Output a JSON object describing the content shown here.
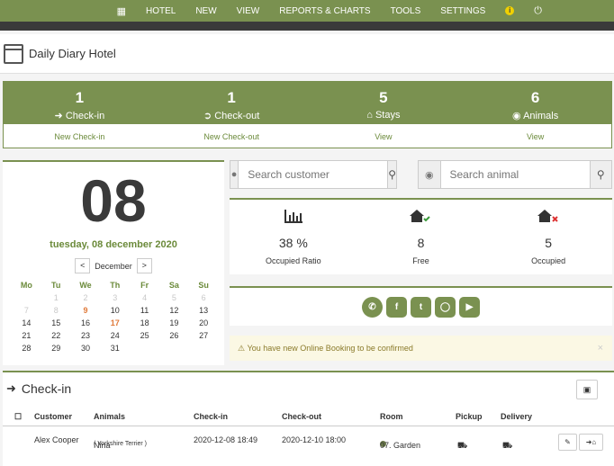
{
  "nav": {
    "items": [
      "HOTEL",
      "NEW",
      "VIEW",
      "REPORTS & CHARTS",
      "TOOLS",
      "SETTINGS"
    ],
    "info_icon": "info-icon",
    "power_icon": "power-icon",
    "grid_icon": "grid-icon"
  },
  "title": "Daily Diary Hotel",
  "stats": [
    {
      "num": "1",
      "label": "Check-in",
      "link": "New Check-in",
      "icon": "sign-in-icon"
    },
    {
      "num": "1",
      "label": "Check-out",
      "link": "New Check-out",
      "icon": "sign-out-icon"
    },
    {
      "num": "5",
      "label": "Stays",
      "link": "View",
      "icon": "home-icon"
    },
    {
      "num": "6",
      "label": "Animals",
      "link": "View",
      "icon": "animal-icon"
    }
  ],
  "date": {
    "day": "08",
    "full": "tuesday, 08 december 2020",
    "month": "December",
    "prev": "<",
    "next": ">",
    "weekdays": [
      "Mo",
      "Tu",
      "We",
      "Th",
      "Fr",
      "Sa",
      "Su"
    ],
    "weeks": [
      [
        "",
        "1",
        "2",
        "3",
        "4",
        "5",
        "6"
      ],
      [
        "7",
        "8",
        "9",
        "10",
        "11",
        "12",
        "13"
      ],
      [
        "14",
        "15",
        "16",
        "17",
        "18",
        "19",
        "20"
      ],
      [
        "21",
        "22",
        "23",
        "24",
        "25",
        "26",
        "27"
      ],
      [
        "28",
        "29",
        "30",
        "31",
        "",
        "",
        ""
      ]
    ]
  },
  "search": {
    "customer_placeholder": "Search customer",
    "animal_placeholder": "Search animal"
  },
  "occupancy": [
    {
      "value": "38 %",
      "label": "Occupied Ratio",
      "icon": "bar-chart-icon"
    },
    {
      "value": "8",
      "label": "Free",
      "icon": "house-check-icon"
    },
    {
      "value": "5",
      "label": "Occupied",
      "icon": "house-x-icon"
    }
  ],
  "social": [
    "whatsapp-icon",
    "facebook-icon",
    "twitter-icon",
    "instagram-icon",
    "youtube-icon"
  ],
  "alert": {
    "text": "You have new Online Booking to be confirmed",
    "close": "×"
  },
  "checkin": {
    "title": "Check-in",
    "columns": [
      "Customer",
      "Animals",
      "Check-in",
      "Check-out",
      "Room",
      "Pickup",
      "Delivery"
    ],
    "rows": [
      {
        "customer": "Alex Cooper",
        "animal": "Nina",
        "breed": "( Yorkshire Terrier )",
        "checkin": "2020-12-08 18:49",
        "checkout": "2020-12-10 18:00",
        "room": "07. Garden",
        "room_color": "#6b7a4a"
      }
    ]
  }
}
